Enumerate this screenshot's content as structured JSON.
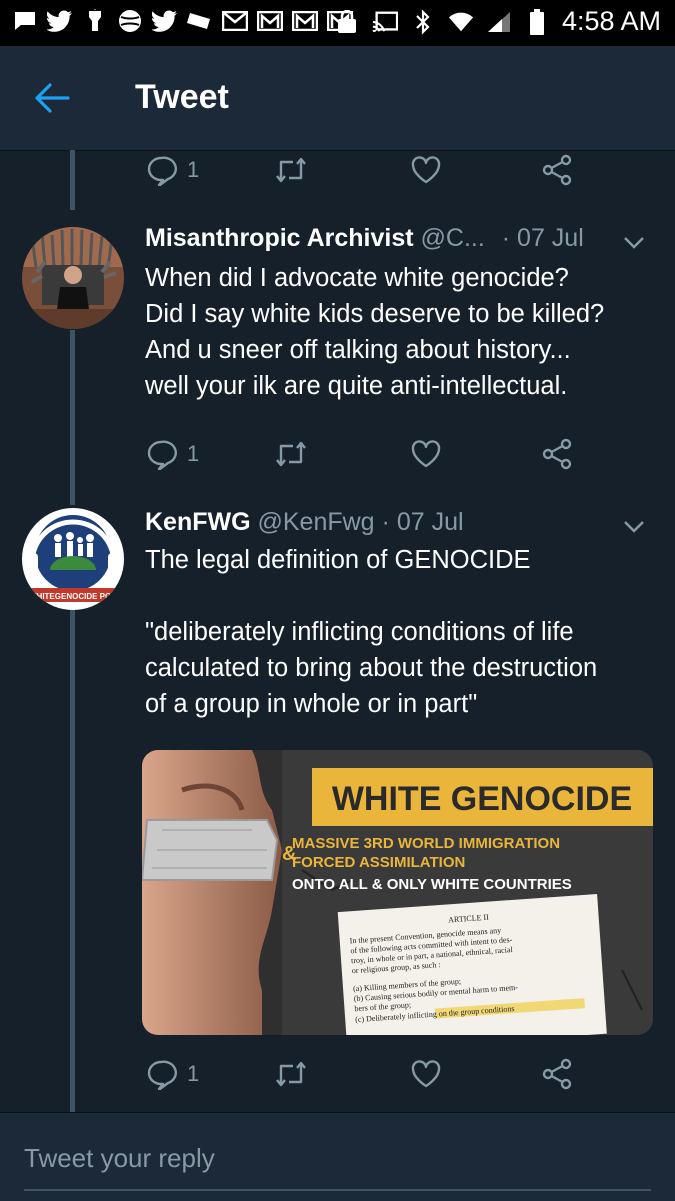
{
  "status_bar": {
    "time": "4:58 AM",
    "icons": [
      "message-icon",
      "twitter-icon",
      "flashlight-icon",
      "ball-icon",
      "twitter-icon",
      "ticket-icon",
      "gmail-icon",
      "gmail-icon",
      "gmail-icon",
      "gmail-icon",
      "lock-icon",
      "cast-icon",
      "bluetooth-icon",
      "wifi-icon",
      "signal-icon",
      "battery-icon"
    ]
  },
  "appbar": {
    "title": "Tweet"
  },
  "tweets": [
    {
      "reply_count": "1"
    },
    {
      "name": "Misanthropic Archivist",
      "handle": "@C...",
      "date": "· 07 Jul",
      "lines": [
        "When did I advocate white genocide?",
        "Did I say white kids deserve to be killed?",
        "And u sneer off talking about history...",
        "well your ilk are quite anti-intellectual."
      ],
      "reply_count": "1"
    },
    {
      "name": "KenFWG",
      "handle": "@KenFwg",
      "date": "· 07 Jul",
      "avatar_caption": "WHITEGENOCIDE POD",
      "lines": [
        "The legal definition of GENOCIDE",
        "\"deliberately inflicting conditions of life",
        "calculated to bring about the destruction",
        "of a group in whole or in part\""
      ],
      "media": {
        "headline": "WHITE GENOCIDE",
        "ampersand": "&",
        "sub1": "MASSIVE 3RD WORLD IMMIGRATION",
        "sub2": "FORCED ASSIMILATION",
        "sub3": "ONTO ALL & ONLY WHITE COUNTRIES",
        "doc_title": "ARTICLE II",
        "doc_lines": [
          "In the present Convention, genocide means any",
          "of the following acts committed with intent to des-",
          "troy, in whole or in part, a national, ethnical, racial",
          "or religious group, as such :",
          "(a) Killing members of the group;",
          "(b) Causing serious bodily or mental harm to mem-",
          "bers of the group;",
          "(c) Deliberately inflicting on the group conditions"
        ]
      },
      "reply_count": "1"
    }
  ],
  "reply_input": {
    "placeholder": "Tweet your reply"
  },
  "colors": {
    "background": "#15202b",
    "appbar": "#1c2938",
    "accent": "#1da1f2",
    "muted": "#8899a6",
    "thread": "#3d5466"
  }
}
